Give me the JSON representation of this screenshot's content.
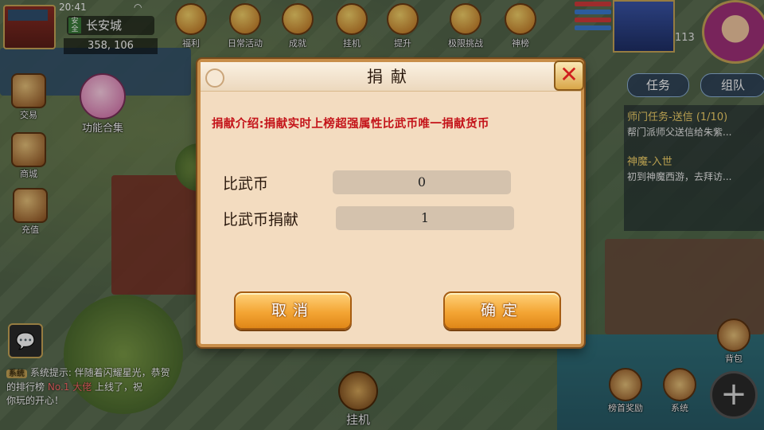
{
  "status": {
    "time": "20:41",
    "wifi_icon": "wifi-icon"
  },
  "location": {
    "tag": "安全",
    "city": "长安城",
    "coords": "358, 106"
  },
  "top_bar": {
    "items": [
      {
        "label": "福利",
        "icon": "gift-icon"
      },
      {
        "label": "日常活动",
        "icon": "lantern-icon"
      },
      {
        "label": "成就",
        "icon": "medal-icon"
      },
      {
        "label": "挂机",
        "icon": "sword-icon"
      },
      {
        "label": "提升",
        "icon": "arrow-up-icon"
      },
      {
        "label": "极限挑战",
        "icon": "shield-icon"
      },
      {
        "label": "神榜",
        "icon": "ranking-icon"
      }
    ],
    "level": "113"
  },
  "left_side": {
    "items": [
      {
        "label": "交易",
        "icon": "trade-icon"
      },
      {
        "label": "商城",
        "icon": "shop-icon"
      },
      {
        "label": "充值",
        "icon": "coin-icon"
      }
    ],
    "combo_label": "功能合集"
  },
  "right_panel": {
    "tabs": [
      "任务",
      "组队"
    ],
    "tasks": [
      {
        "title": "师门任务-送信 (1/10)",
        "desc": "帮门派师父送信给朱紫..."
      },
      {
        "title": "神魔-入世",
        "desc": "初到神魔西游，去拜访..."
      }
    ]
  },
  "chat": {
    "sys_tag": "系统",
    "line1": "系统提示: 伴随着闪耀星光，恭贺",
    "line2_pre": "的排行榜",
    "line2_hl": "No.1 大佬",
    "line2_post": "上线了，祝",
    "line3": "你玩的开心！"
  },
  "bottom": {
    "auto_label": "挂机",
    "items": [
      {
        "label": "榜首奖励",
        "icon": "trophy-icon"
      },
      {
        "label": "系统",
        "icon": "settings-icon"
      },
      {
        "label": "背包",
        "icon": "bag-icon"
      }
    ],
    "plus_icon": "plus-icon"
  },
  "dialog": {
    "title": "捐献",
    "close_glyph": "✕",
    "intro": "捐献介绍:捐献实时上榜超强属性比武币唯一捐献货币",
    "fields": [
      {
        "label": "比武币",
        "value": "0"
      },
      {
        "label": "比武币捐献",
        "value": "1"
      }
    ],
    "cancel_label": "取消",
    "confirm_label": "确定"
  },
  "colors": {
    "dialog_bg": "#f3dcc0",
    "intro_red": "#c4141a",
    "button_orange": "#f3a534",
    "close_red": "#d01e1e"
  }
}
